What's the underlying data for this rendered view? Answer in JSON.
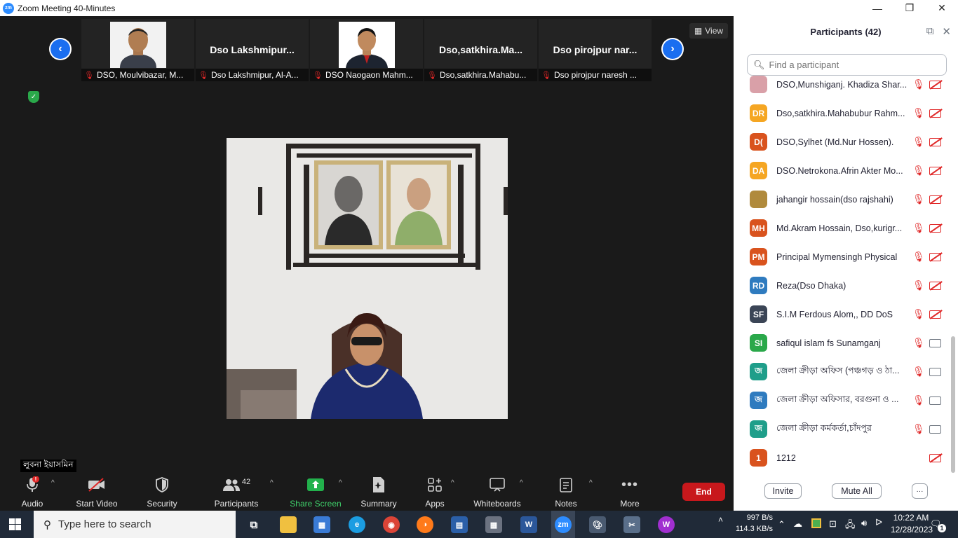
{
  "window": {
    "title": "Zoom Meeting 40-Minutes",
    "app_icon": "zm"
  },
  "thumbnails": [
    {
      "caption": "DSO, Moulvibazar, M...",
      "big_name": "",
      "has_photo": true
    },
    {
      "caption": "Dso Lakshmipur, Al-A...",
      "big_name": "Dso Lakshmipur...",
      "has_photo": false
    },
    {
      "caption": "DSO Naogaon Mahm...",
      "big_name": "",
      "has_photo": true
    },
    {
      "caption": "Dso,satkhira.Mahabu...",
      "big_name": "Dso,satkhira.Ma...",
      "has_photo": false
    },
    {
      "caption": "Dso pirojpur naresh ...",
      "big_name": "Dso pirojpur nar...",
      "has_photo": false
    }
  ],
  "view_label": "View",
  "active_speaker": "লুবনা ইয়াসমিন",
  "toolbar": {
    "audio": "Audio",
    "start_video": "Start Video",
    "security": "Security",
    "participants": "Participants",
    "participants_count": "42",
    "share_screen": "Share Screen",
    "summary": "Summary",
    "apps": "Apps",
    "whiteboards": "Whiteboards",
    "notes": "Notes",
    "more": "More",
    "end": "End"
  },
  "panel": {
    "title": "Participants (42)",
    "search_placeholder": "Find a participant",
    "participants": [
      {
        "initials": "",
        "color": "#d9a0a8",
        "name": "DSO,Munshiganj. Khadiza Shar...",
        "camera": "off"
      },
      {
        "initials": "DR",
        "color": "#f5a623",
        "name": "Dso,satkhira.Mahabubur Rahm...",
        "camera": "off"
      },
      {
        "initials": "D(",
        "color": "#d9531e",
        "name": "DSO,Sylhet (Md.Nur Hossen).",
        "camera": "off"
      },
      {
        "initials": "DA",
        "color": "#f5a623",
        "name": "DSO.Netrokona.Afrin Akter Mo...",
        "camera": "off"
      },
      {
        "initials": "",
        "color": "#b08a3c",
        "name": "jahangir hossain(dso rajshahi)",
        "camera": "off"
      },
      {
        "initials": "MH",
        "color": "#d9531e",
        "name": "Md.Akram Hossain, Dso,kurigr...",
        "camera": "off"
      },
      {
        "initials": "PM",
        "color": "#d9531e",
        "name": "Principal Mymensingh Physical",
        "camera": "off"
      },
      {
        "initials": "RD",
        "color": "#2f7bbf",
        "name": "Reza(Dso Dhaka)",
        "camera": "off"
      },
      {
        "initials": "SF",
        "color": "#3b4556",
        "name": "S.I.M Ferdous Alom,, DD DoS",
        "camera": "off"
      },
      {
        "initials": "SI",
        "color": "#2aa84a",
        "name": "safiqul islam fs Sunamganj",
        "camera": "on"
      },
      {
        "initials": "জ",
        "color": "#1f9e8a",
        "name": "জেলা ক্রীড়া অফিস (পঞ্চগড় ও ঠা...",
        "camera": "on"
      },
      {
        "initials": "জ",
        "color": "#2f7bbf",
        "name": "জেলা ক্রীড়া অফিসার, বরগুনা ও ...",
        "camera": "on"
      },
      {
        "initials": "জ",
        "color": "#1f9e8a",
        "name": "জেলা ক্রীড়া কর্মকর্তা,চাঁদপুর",
        "camera": "on"
      },
      {
        "initials": "1",
        "color": "#d9531e",
        "name": "1212",
        "camera": "off",
        "no_mic": true
      }
    ],
    "invite": "Invite",
    "mute_all": "Mute All",
    "more": "···"
  },
  "taskbar": {
    "search_placeholder": "Type here to search",
    "net_up": "997 B/s",
    "net_down": "114.3 KB/s",
    "time": "10:22 AM",
    "date": "12/28/2023",
    "notification_count": "1"
  }
}
